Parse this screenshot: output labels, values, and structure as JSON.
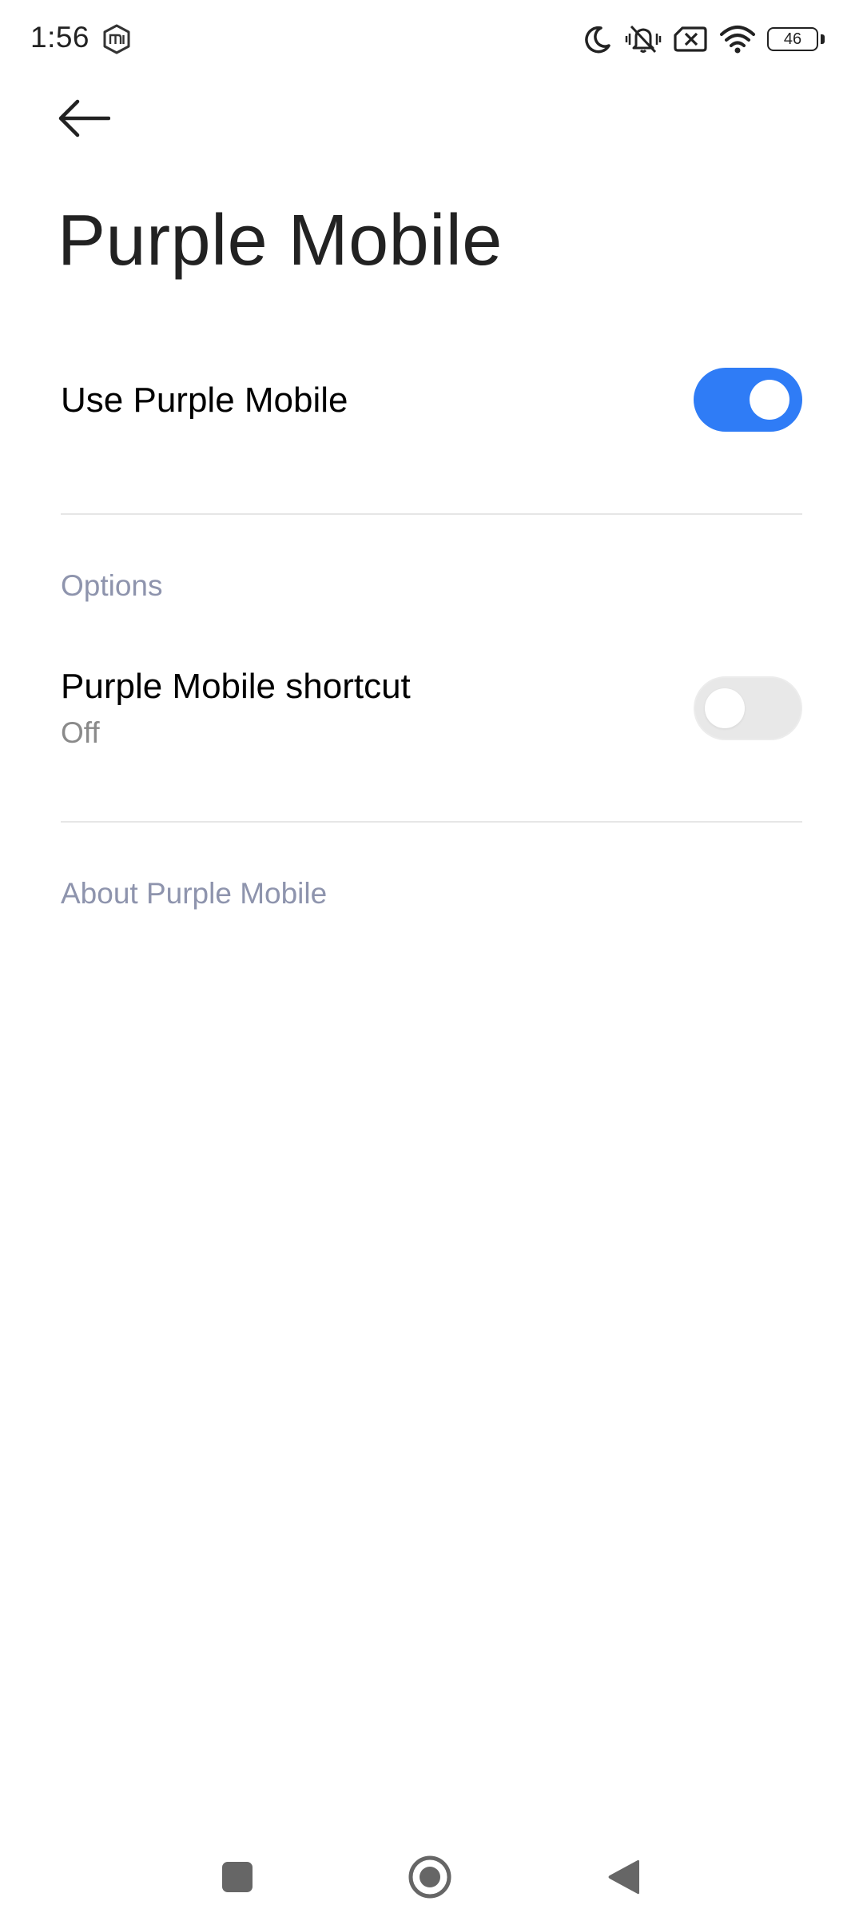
{
  "status_bar": {
    "time": "1:56",
    "battery_level": "46",
    "icons": [
      "mi-badge-icon",
      "moon-icon",
      "vibrate-off-icon",
      "no-sim-icon",
      "wifi-icon",
      "battery-icon"
    ]
  },
  "header": {
    "back_icon": "arrow-left-icon",
    "title": "Purple Mobile"
  },
  "main_switch": {
    "label": "Use Purple Mobile",
    "enabled": true
  },
  "options": {
    "header": "Options",
    "shortcut": {
      "title": "Purple Mobile shortcut",
      "summary": "Off",
      "enabled": false
    }
  },
  "about": {
    "label": "About Purple Mobile"
  },
  "colors": {
    "accent": "#2f7cf6",
    "section_header": "#8e94ad",
    "divider": "#e6e6e6",
    "toggle_off": "#e8e8e8"
  },
  "nav_bar": {
    "buttons": [
      "recents-icon",
      "home-icon",
      "back-icon"
    ]
  }
}
